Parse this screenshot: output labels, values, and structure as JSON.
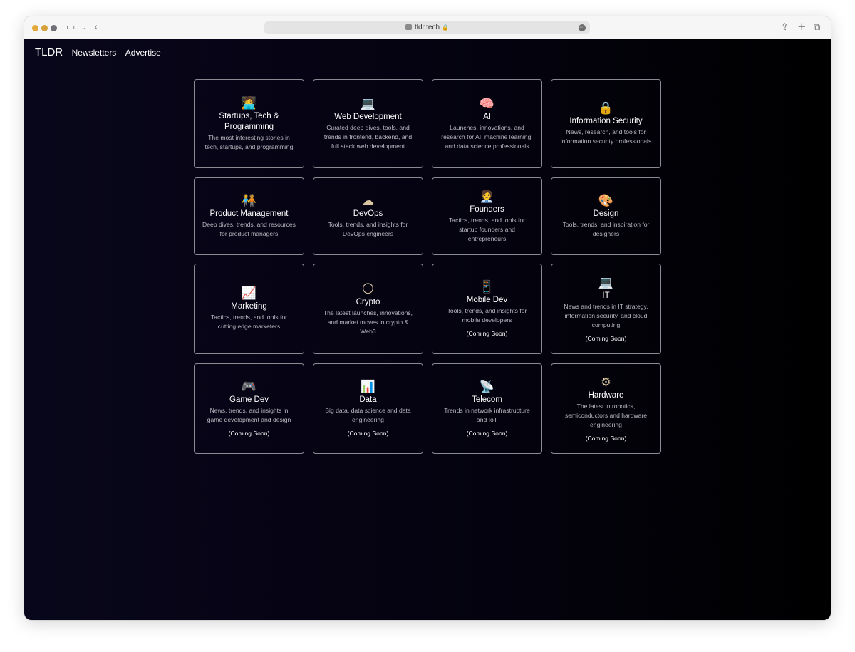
{
  "browser": {
    "url": "tldr.tech"
  },
  "nav": {
    "brand": "TLDR",
    "links": [
      "Newsletters",
      "Advertise"
    ]
  },
  "cards": [
    {
      "icon": "technologist-icon",
      "glyph": "🧑‍💻",
      "title": "Startups, Tech & Programming",
      "desc": "The most interesting stories in tech, startups, and programming",
      "soon": ""
    },
    {
      "icon": "laptop-icon",
      "glyph": "💻",
      "title": "Web Development",
      "desc": "Curated deep dives, tools, and trends in frontend, backend, and full stack web development",
      "soon": ""
    },
    {
      "icon": "brain-icon",
      "glyph": "🧠",
      "title": "AI",
      "desc": "Launches, innovations, and research for AI, machine learning, and data science professionals",
      "soon": ""
    },
    {
      "icon": "lock-icon",
      "glyph": "🔒",
      "title": "Information Security",
      "desc": "News, research, and tools for information security professionals",
      "soon": ""
    },
    {
      "icon": "people-icon",
      "glyph": "🧑‍🤝‍🧑",
      "title": "Product Management",
      "desc": "Deep dives, trends, and resources for product managers",
      "soon": ""
    },
    {
      "icon": "cloud-icon",
      "glyph": "☁",
      "title": "DevOps",
      "desc": "Tools, trends, and insights for DevOps engineers",
      "soon": ""
    },
    {
      "icon": "founder-icon",
      "glyph": "🧑‍💼",
      "title": "Founders",
      "desc": "Tactics, trends, and tools for startup founders and entrepreneurs",
      "soon": ""
    },
    {
      "icon": "palette-icon",
      "glyph": "🎨",
      "title": "Design",
      "desc": "Tools, trends, and inspiration for designers",
      "soon": ""
    },
    {
      "icon": "chart-increasing-icon",
      "glyph": "📈",
      "title": "Marketing",
      "desc": "Tactics, trends, and tools for cutting edge marketers",
      "soon": ""
    },
    {
      "icon": "coin-icon",
      "glyph": "🌕",
      "title": "Crypto",
      "desc": "The latest launches, innovations, and market moves in crypto & Web3",
      "soon": ""
    },
    {
      "icon": "mobile-phone-icon",
      "glyph": "📱",
      "title": "Mobile Dev",
      "desc": "Tools, trends, and insights for mobile developers",
      "soon": "(Coming Soon)"
    },
    {
      "icon": "desktop-icon",
      "glyph": "💻",
      "title": "IT",
      "desc": "News and trends in IT strategy, information security, and cloud computing",
      "soon": "(Coming Soon)"
    },
    {
      "icon": "gamepad-icon",
      "glyph": "🎮",
      "title": "Game Dev",
      "desc": "News, trends, and insights in game development and design",
      "soon": "(Coming Soon)"
    },
    {
      "icon": "bar-chart-icon",
      "glyph": "📊",
      "title": "Data",
      "desc": "Big data, data science and data engineering",
      "soon": "(Coming Soon)"
    },
    {
      "icon": "satellite-dish-icon",
      "glyph": "📡",
      "title": "Telecom",
      "desc": "Trends in network infrastructure and IoT",
      "soon": "(Coming Soon)"
    },
    {
      "icon": "gear-icon",
      "glyph": "⚙",
      "title": "Hardware",
      "desc": "The latest in robotics, semiconductors and hardware engineering",
      "soon": "(Coming Soon)"
    }
  ]
}
